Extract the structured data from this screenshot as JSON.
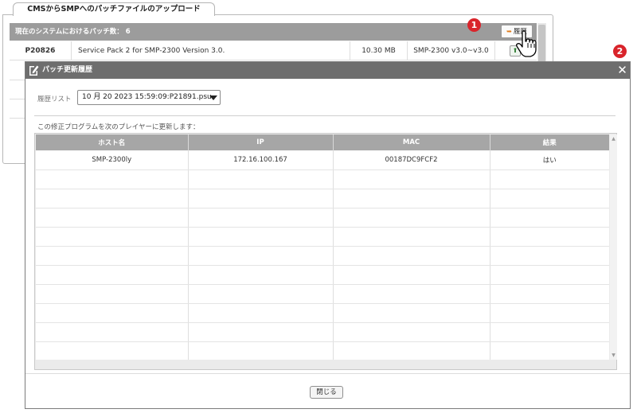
{
  "background": {
    "tab_title": "CMSからSMPへのパッチファイルのアップロード",
    "header_text": "現在のシステムにおけるパッチ数： 6",
    "history_button_label": "履歴",
    "patch_row": {
      "id": "P20826",
      "name": "Service Pack 2 for SMP-2300 Version 3.0.",
      "size": "10.30 MB",
      "version": "SMP-2300 v3.0~v3.0"
    }
  },
  "markers": {
    "first": "1",
    "second": "2"
  },
  "dialog": {
    "title": "パッチ更新履歴",
    "close_symbol": "✕",
    "history_list_label": "履歴リスト",
    "history_selected": "10 月 20 2023 15:59:09:P21891.psu",
    "update_caption": "この修正プログラムを次のプレイヤーに更新します：",
    "table": {
      "columns": [
        "ホスト名",
        "IP",
        "MAC",
        "結果"
      ],
      "rows": [
        [
          "SMP-2300ly",
          "172.16.100.167",
          "00187DC9FCF2",
          "はい"
        ]
      ]
    },
    "close_button_label": "閉じる"
  },
  "colors": {
    "titlebar": "#6e6e6e",
    "header": "#a6a6a6",
    "marker": "#d9242b",
    "history_icon": "#e07b1a"
  },
  "icons": {
    "history": "arrow-right-icon",
    "upload": "upload-icon",
    "dialog": "document-edit-icon",
    "cursor": "hand-pointer-icon",
    "close": "close-icon",
    "select_arrow": "chevron-down-icon"
  }
}
